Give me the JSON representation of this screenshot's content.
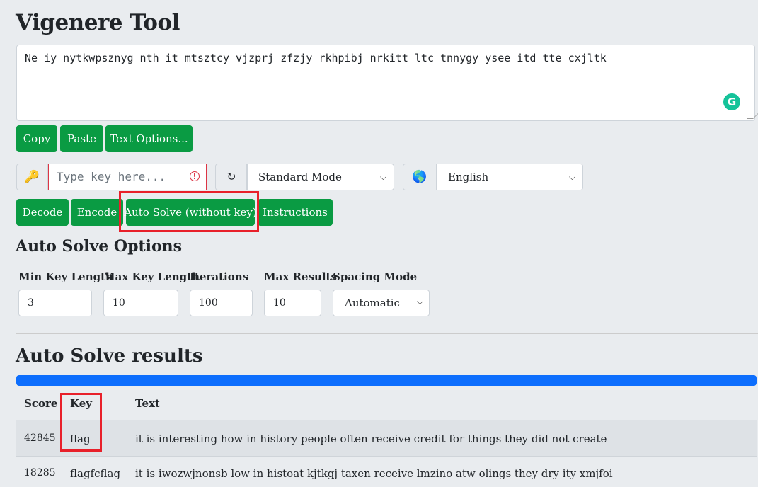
{
  "page": {
    "title": "Vigenere Tool"
  },
  "input": {
    "ciphertext": "Ne iy nytkwpsznyg nth it mtsztcy vjzprj zfzjy rkhpibj nrkitt ltc tnnygy ysee itd tte cxjltk",
    "grammarly_icon": "G"
  },
  "text_buttons": {
    "copy": "Copy",
    "paste": "Paste",
    "text_options": "Text Options..."
  },
  "key": {
    "icon": "🔑",
    "placeholder": "Type key here...",
    "warning_icon": "!"
  },
  "mode": {
    "icon": "↻",
    "selected": "Standard Mode"
  },
  "language": {
    "icon": "🌎",
    "selected": "English"
  },
  "actions": {
    "decode": "Decode",
    "encode": "Encode",
    "auto_solve": "Auto Solve (without key)",
    "instructions": "Instructions"
  },
  "auto_solve_options": {
    "title": "Auto Solve Options",
    "min_key_length": {
      "label": "Min Key Length",
      "value": "3"
    },
    "max_key_length": {
      "label": "Max Key Length",
      "value": "10"
    },
    "iterations": {
      "label": "Iterations",
      "value": "100"
    },
    "max_results": {
      "label": "Max Results",
      "value": "10"
    },
    "spacing_mode": {
      "label": "Spacing Mode",
      "value": "Automatic"
    }
  },
  "results": {
    "title": "Auto Solve results",
    "progress": 1.0,
    "columns": [
      "Score",
      "Key",
      "Text"
    ],
    "rows": [
      {
        "score": "42845",
        "key": "flag",
        "text": "it is interesting how in history people often receive credit for things they did not create"
      },
      {
        "score": "18285",
        "key": "flagfcflag",
        "text": "it is iwozwjnonsb low in histoat kjtkgj taxen receive lmzino atw olings they dry ity xmjfoi"
      }
    ]
  },
  "colors": {
    "primary_button": "#0a9b43",
    "progress": "#0d6efd",
    "highlight": "#e8202a",
    "error": "#dc3545"
  }
}
